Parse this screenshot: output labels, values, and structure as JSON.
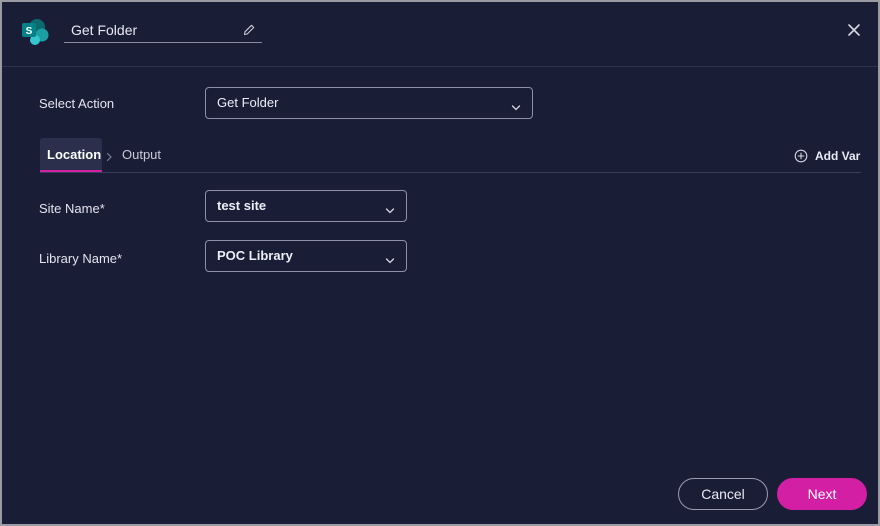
{
  "header": {
    "title": "Get Folder",
    "logo_icon": "sharepoint-icon",
    "edit_icon": "pencil-icon",
    "close_icon": "close-icon"
  },
  "form": {
    "select_action": {
      "label": "Select Action",
      "value": "Get Folder"
    },
    "tabs": [
      {
        "label": "Location",
        "active": true
      },
      {
        "label": "Output",
        "active": false
      }
    ],
    "add_var": {
      "label": "Add Var",
      "icon": "plus-circle-icon"
    },
    "site_name": {
      "label": "Site Name*",
      "value": "test site"
    },
    "library_name": {
      "label": "Library Name*",
      "value": "POC Library"
    }
  },
  "footer": {
    "cancel_label": "Cancel",
    "next_label": "Next"
  },
  "colors": {
    "background": "#1a1d36",
    "accent": "#d21fa3",
    "border": "#8d90a8"
  }
}
